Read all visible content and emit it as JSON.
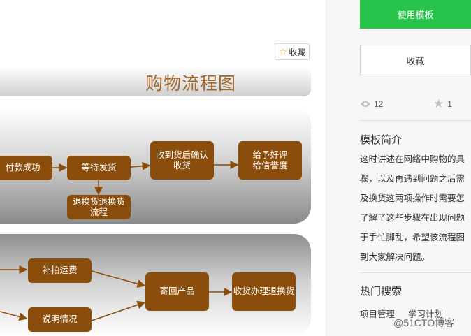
{
  "canvas": {
    "favorite_button": {
      "label": "收藏",
      "icon": "star-outline-icon"
    },
    "diagram_title": "购物流程图",
    "nodes": {
      "paid": "付款成功",
      "await_shipping": "等待发货",
      "receive_confirm": "收到货后确认收货",
      "give_review": "给予好评给信誉度",
      "return_exchange": "退换货退换货流程",
      "extra_shipping": "补拍运费",
      "explain": "说明情况",
      "send_back": "寄回产品",
      "receive_exchange": "收货办理退换货"
    },
    "colors": {
      "node_fill": "#8b4d0c",
      "title_text": "#a0662a",
      "arrow": "#8b4d0c"
    }
  },
  "sidebar": {
    "use_button": "使用模板",
    "collect_button": "收藏",
    "views": {
      "icon": "eye-icon",
      "count": "12"
    },
    "stars": {
      "icon": "star-icon",
      "count": "1"
    },
    "intro_title": "模板简介",
    "intro_lines": [
      "这时讲述在网络中购物的具",
      "骤，以及再遇到问题之后需",
      "及换货这两项操作时需要怎",
      "了解了这些步骤在出现问题",
      "于手忙脚乱，希望该流程图",
      "到大家解决问题。"
    ],
    "hot_search_title": "热门搜索",
    "hot_tags": [
      "项目管理",
      "学习计划"
    ],
    "colors": {
      "use_button": "#27c24a"
    }
  },
  "watermark": "@51CTO博客"
}
